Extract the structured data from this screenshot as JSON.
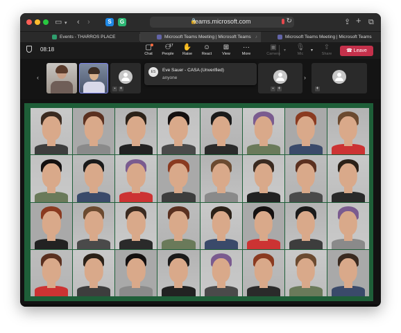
{
  "browser": {
    "url": "teams.microsoft.com",
    "tabs": [
      {
        "label": "Events - THARROS PLACE",
        "active": false,
        "favicon_color": "#2f9e6e"
      },
      {
        "label": "Microsoft Teams Meeting | Microsoft Teams",
        "active": true,
        "favicon_color": "#6264a7"
      },
      {
        "label": "Microsoft Teams Meeting | Microsoft Teams",
        "active": false,
        "favicon_color": "#6264a7"
      }
    ]
  },
  "meeting": {
    "elapsed": "08:18",
    "toolbar": {
      "chat": "Chat",
      "people": "People",
      "people_count": "17",
      "raise": "Raise",
      "react": "React",
      "view": "View",
      "more": "More",
      "camera": "Camera",
      "mic": "Mic",
      "share": "Share",
      "leave": "Leave"
    },
    "hover_card": {
      "initials": "ES",
      "name": "Eve Sauer - CASA (Unverified)",
      "status": "anyone"
    }
  },
  "shared_content": {
    "rows": 4,
    "columns": 8,
    "frame_color": "#1e5e38"
  }
}
